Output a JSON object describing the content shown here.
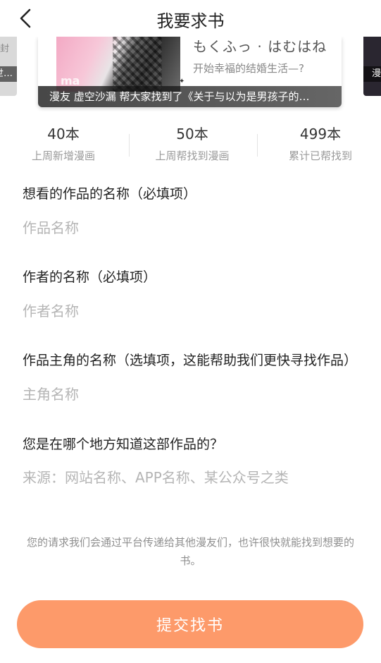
{
  "header": {
    "title": "我要求书"
  },
  "carousel": {
    "left_card_text": "封",
    "left_card_caption": "世…",
    "right_card_caption": "漫",
    "main": {
      "title_jp": "もくふっ · はむはね",
      "description": "开始幸福的结婚生活—?",
      "cover_mark": "ma",
      "caption": "漫友 虚空沙漏 帮大家找到了《关于与以为是男孩子的…"
    }
  },
  "stats": [
    {
      "value": "40本",
      "label": "上周新增漫画"
    },
    {
      "value": "50本",
      "label": "上周帮找到漫画"
    },
    {
      "value": "499本",
      "label": "累计已帮找到"
    }
  ],
  "form": {
    "work_name": {
      "label": "想看的作品的名称（必填项）",
      "placeholder": "作品名称"
    },
    "author_name": {
      "label": "作者的名称（必填项）",
      "placeholder": "作者名称"
    },
    "protagonist": {
      "label": "作品主角的名称（选填项，这能帮助我们更快寻找作品）",
      "placeholder": "主角名称"
    },
    "source": {
      "label": "您是在哪个地方知道这部作品的？",
      "placeholder": "来源：网站名称、APP名称、某公众号之类"
    }
  },
  "hint": "您的请求我们会通过平台传递给其他漫友们，也许很快就能找到想要的书。",
  "submit_label": "提交找书",
  "colors": {
    "accent": "#fd9a6a"
  }
}
